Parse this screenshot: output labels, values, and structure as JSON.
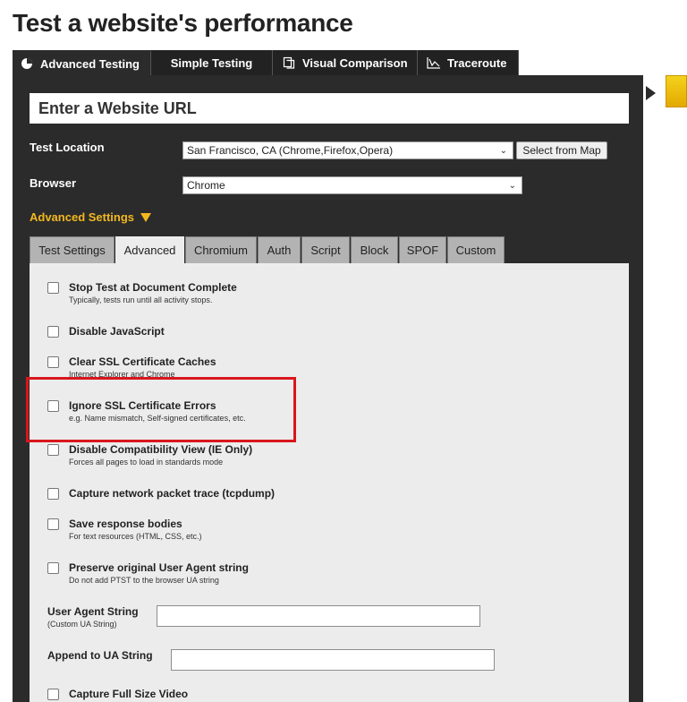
{
  "page": {
    "title": "Test a website's performance"
  },
  "main_tabs": [
    {
      "label": "Advanced Testing",
      "icon": "pie-chart-icon",
      "active": true
    },
    {
      "label": "Simple Testing",
      "active": false
    },
    {
      "label": "Visual Comparison",
      "icon": "document-copy-icon",
      "active": false
    },
    {
      "label": "Traceroute",
      "icon": "traceroute-icon",
      "active": false
    }
  ],
  "url_input": {
    "placeholder": "Enter a Website URL"
  },
  "test_location": {
    "label": "Test Location",
    "value": "San Francisco, CA (Chrome,Firefox,Opera)",
    "map_button": "Select from Map"
  },
  "browser": {
    "label": "Browser",
    "value": "Chrome"
  },
  "advanced_settings": {
    "label": "Advanced Settings"
  },
  "inner_tabs": [
    {
      "label": "Test Settings",
      "active": false
    },
    {
      "label": "Advanced",
      "active": true
    },
    {
      "label": "Chromium",
      "active": false
    },
    {
      "label": "Auth",
      "active": false
    },
    {
      "label": "Script",
      "active": false
    },
    {
      "label": "Block",
      "active": false
    },
    {
      "label": "SPOF",
      "active": false
    },
    {
      "label": "Custom",
      "active": false
    }
  ],
  "options": [
    {
      "title": "Stop Test at Document Complete",
      "desc": "Typically, tests run until all activity stops.",
      "checked": false
    },
    {
      "title": "Disable JavaScript",
      "desc": "",
      "checked": false
    },
    {
      "title": "Clear SSL Certificate Caches",
      "desc": "Internet Explorer and Chrome",
      "checked": false
    },
    {
      "title": "Ignore SSL Certificate Errors",
      "desc": "e.g. Name mismatch, Self-signed certificates, etc.",
      "checked": false
    },
    {
      "title": "Disable Compatibility View (IE Only)",
      "desc": "Forces all pages to load in standards mode",
      "checked": false
    },
    {
      "title": "Capture network packet trace (tcpdump)",
      "desc": "",
      "checked": false
    },
    {
      "title": "Save response bodies",
      "desc": "For text resources (HTML, CSS, etc.)",
      "checked": false
    },
    {
      "title": "Preserve original User Agent string",
      "desc": "Do not add PTST to the browser UA string",
      "checked": false
    },
    {
      "title": "Capture Full Size Video",
      "desc": "",
      "checked": false
    }
  ],
  "user_agent": {
    "label": "User Agent String",
    "sublabel": "(Custom UA String)",
    "value": ""
  },
  "append_ua": {
    "label": "Append to UA String",
    "value": ""
  },
  "colors": {
    "panel_dark": "#2b2b2b",
    "accent_yellow": "#f3b81f",
    "highlight_red": "#d9161d",
    "inner_panel": "#ececec"
  }
}
